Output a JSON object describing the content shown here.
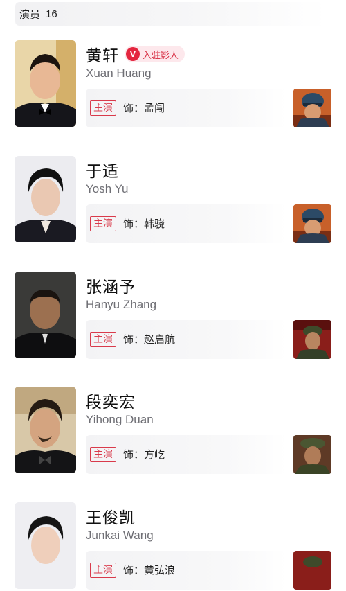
{
  "header": {
    "label": "演员",
    "count": "16"
  },
  "actors": [
    {
      "cn_name": "黄轩",
      "en_name": "Xuan Huang",
      "badge": "入驻影人",
      "badge_v": "V",
      "role_tag": "主演",
      "role": "饰：孟闯",
      "poster": "firefighter-poster"
    },
    {
      "cn_name": "于适",
      "en_name": "Yosh Yu",
      "role_tag": "主演",
      "role": "饰：韩骁",
      "poster": "firefighter-poster"
    },
    {
      "cn_name": "张涵予",
      "en_name": "Hanyu Zhang",
      "role_tag": "主演",
      "role": "饰：赵启航",
      "poster": "soldier-poster"
    },
    {
      "cn_name": "段奕宏",
      "en_name": "Yihong Duan",
      "role_tag": "主演",
      "role": "饰：方屹",
      "poster": "soldier-poster"
    },
    {
      "cn_name": "王俊凯",
      "en_name": "Junkai Wang",
      "role_tag": "主演",
      "role": "饰：黄弘浪",
      "poster": "soldier-poster"
    }
  ],
  "colors": {
    "accent": "#d93a4b",
    "badge_bg": "#fde8ec",
    "card_bg": "#f3f3f5"
  }
}
